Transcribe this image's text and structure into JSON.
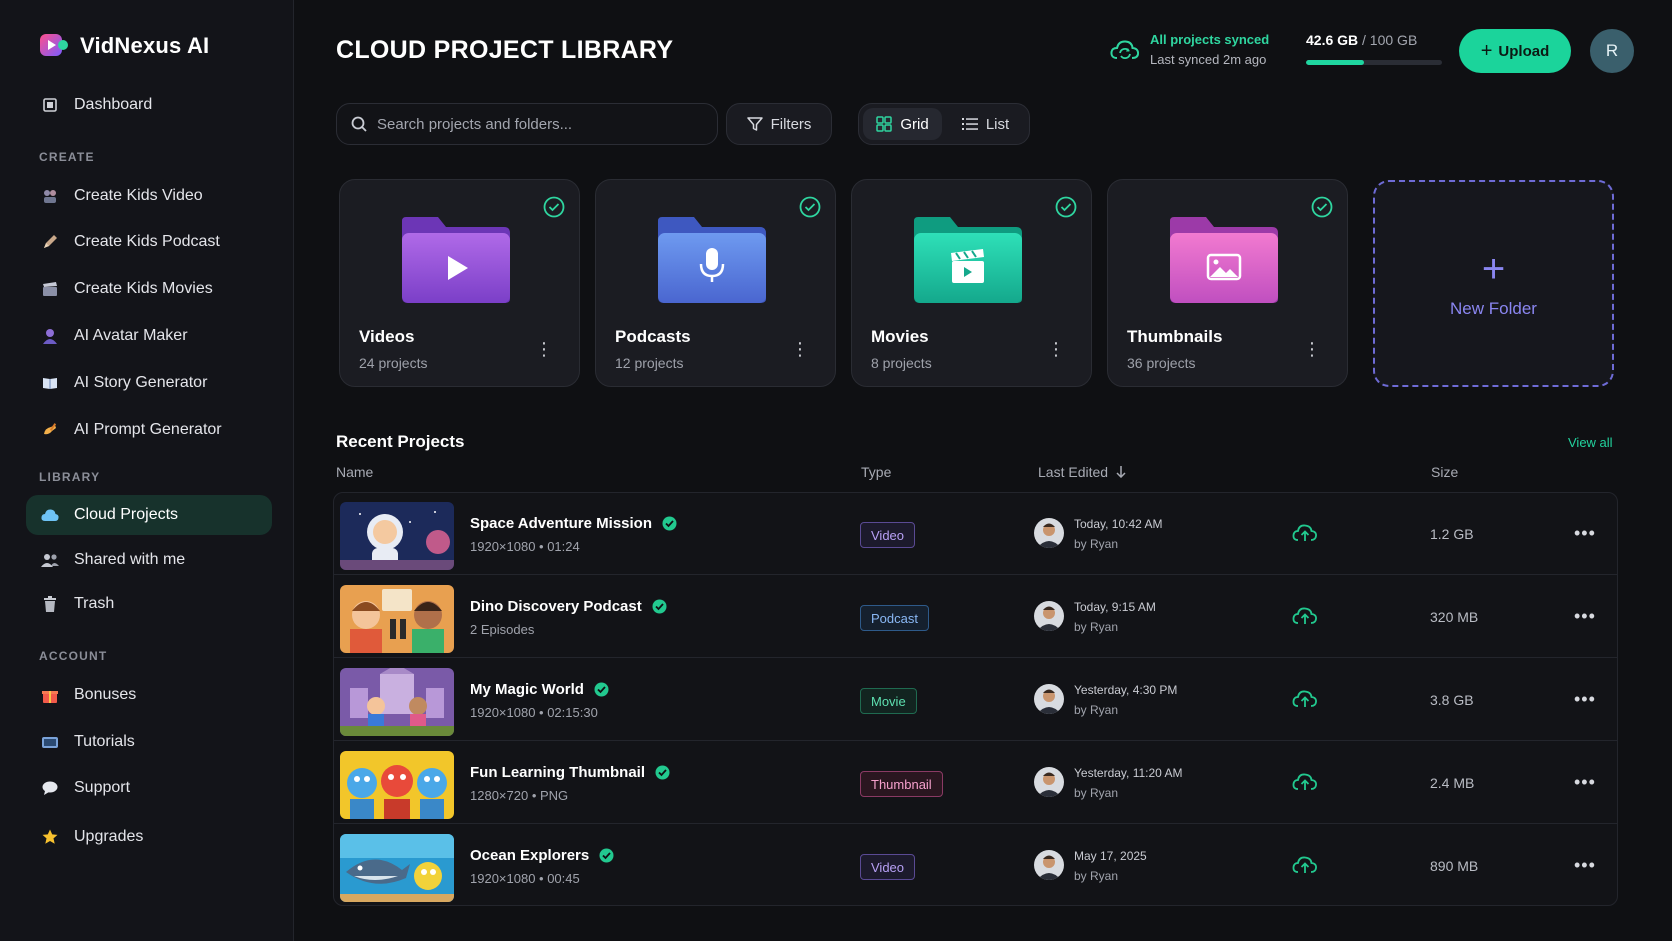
{
  "brand": {
    "name": "VidNexus AI"
  },
  "sidebar": {
    "dashboard": "Dashboard",
    "sections": {
      "create": "CREATE",
      "library": "LIBRARY",
      "account": "ACCOUNT"
    },
    "create_items": [
      {
        "label": "Create Kids Video"
      },
      {
        "label": "Create Kids Podcast"
      },
      {
        "label": "Create Kids Movies"
      },
      {
        "label": "AI Avatar Maker"
      },
      {
        "label": "AI Story Generator"
      },
      {
        "label": "AI Prompt Generator"
      }
    ],
    "library_items": [
      {
        "label": "Cloud Projects",
        "active": true
      },
      {
        "label": "Shared with me"
      },
      {
        "label": "Trash"
      }
    ],
    "account_items": [
      {
        "label": "Bonuses"
      },
      {
        "label": "Tutorials"
      },
      {
        "label": "Support"
      },
      {
        "label": "Upgrades"
      }
    ]
  },
  "header": {
    "title": "CLOUD PROJECT LIBRARY",
    "sync_status": "All projects synced",
    "last_synced": "Last synced 2m ago",
    "storage_used": "42.6 GB",
    "storage_total": "/ 100 GB",
    "storage_fraction": 0.426,
    "upload_label": "Upload",
    "avatar_initial": "R"
  },
  "toolbar": {
    "search_placeholder": "Search projects and folders...",
    "filters_label": "Filters",
    "view_grid": "Grid",
    "view_list": "List"
  },
  "folders": [
    {
      "name": "Videos",
      "count": "24 projects",
      "icon": "play-icon"
    },
    {
      "name": "Podcasts",
      "count": "12 projects",
      "icon": "microphone-icon"
    },
    {
      "name": "Movies",
      "count": "8 projects",
      "icon": "clapperboard-icon"
    },
    {
      "name": "Thumbnails",
      "count": "36 projects",
      "icon": "image-icon"
    }
  ],
  "new_folder_label": "New Folder",
  "recent": {
    "title": "Recent Projects",
    "view_all": "View all",
    "columns": {
      "name": "Name",
      "type": "Type",
      "last_edited": "Last Edited",
      "size": "Size"
    },
    "rows": [
      {
        "name": "Space Adventure Mission",
        "meta": "1920×1080  •  01:24",
        "type": "Video",
        "edited": "Today, 10:42 AM",
        "by": "by Ryan",
        "size": "1.2 GB"
      },
      {
        "name": "Dino Discovery Podcast",
        "meta": "2 Episodes",
        "type": "Podcast",
        "edited": "Today, 9:15 AM",
        "by": "by Ryan",
        "size": "320 MB"
      },
      {
        "name": "My Magic World",
        "meta": "1920×1080  •  02:15:30",
        "type": "Movie",
        "edited": "Yesterday, 4:30 PM",
        "by": "by Ryan",
        "size": "3.8 GB"
      },
      {
        "name": "Fun Learning Thumbnail",
        "meta": "1280×720  •  PNG",
        "type": "Thumbnail",
        "edited": "Yesterday, 11:20 AM",
        "by": "by Ryan",
        "size": "2.4 MB"
      },
      {
        "name": "Ocean Explorers",
        "meta": "1920×1080  •  00:45",
        "type": "Video",
        "edited": "May 17, 2025",
        "by": "by Ryan",
        "size": "890 MB"
      }
    ]
  },
  "colors": {
    "accent": "#1bd49b",
    "video_badge": "#9b7bf0",
    "podcast_badge": "#5aa0f0",
    "movie_badge": "#2fd6a0",
    "thumbnail_badge": "#f07bb8",
    "new_folder": "#8a86f0"
  }
}
